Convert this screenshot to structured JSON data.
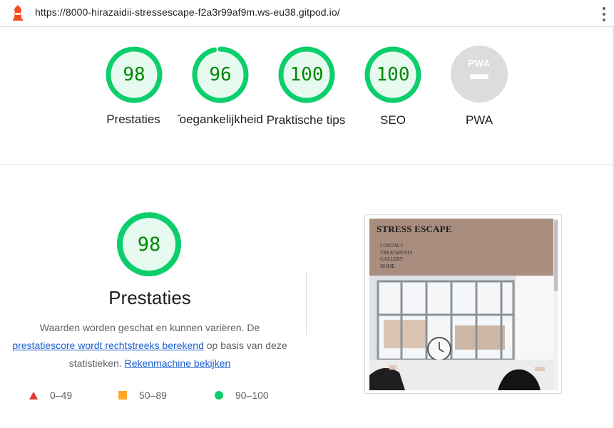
{
  "browser": {
    "url": "https://8000-hirazaidii-stressescape-f2a3r99af9m.ws-eu38.gitpod.io/",
    "logo_icon": "lighthouse-icon",
    "menu_icon": "kebab-menu-icon"
  },
  "scores": [
    {
      "label": "Prestaties",
      "value": "98",
      "score": 0.98
    },
    {
      "label": "Toegankelijkheid",
      "value": "96",
      "score": 0.96
    },
    {
      "label": "Praktische tips",
      "value": "100",
      "score": 1.0
    },
    {
      "label": "SEO",
      "value": "100",
      "score": 1.0
    },
    {
      "label": "PWA",
      "badge": "PWA"
    }
  ],
  "performance": {
    "value": "98",
    "score": 0.98,
    "title": "Prestaties",
    "desc_before": "Waarden worden geschat en kunnen variëren. De",
    "link_score": "prestatiescore wordt rechtstreeks berekend",
    "desc_middle": "op basis van deze statistieken.",
    "link_calc": "Rekenmachine bekijken"
  },
  "legend": [
    {
      "range": "0–49",
      "icon": "fail-triangle-icon",
      "color": "#e53935"
    },
    {
      "range": "50–89",
      "icon": "average-square-icon",
      "color": "#ffa726"
    },
    {
      "range": "90–100",
      "icon": "pass-circle-icon",
      "color": "#0cce6b"
    }
  ],
  "thumbnail": {
    "site_title": "STRESS ESCAPE",
    "nav": [
      "CONTACT",
      "TREATMENTS",
      "GALLERY",
      "HOME"
    ]
  },
  "colors": {
    "pass": "#0cce6b",
    "pass_text": "#008800",
    "pass_fill": "#e7faf0",
    "pwa_gray": "#dcdcdc"
  }
}
